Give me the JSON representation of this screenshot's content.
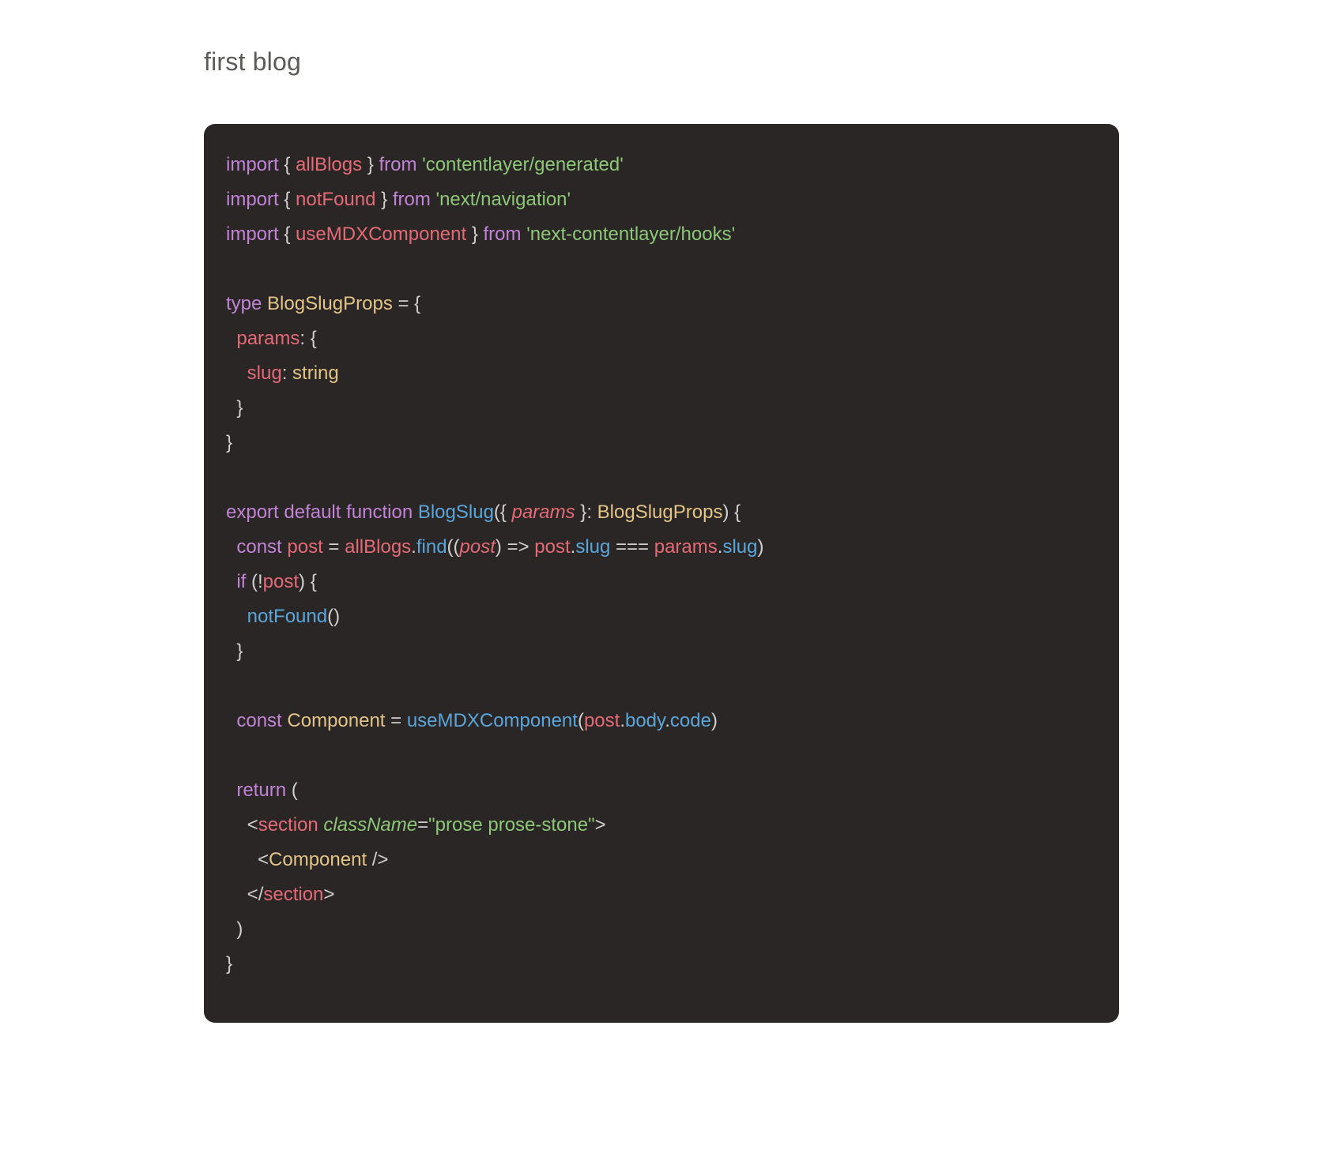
{
  "heading": "first blog",
  "code": {
    "lines": [
      [
        {
          "c": "kw",
          "t": "import"
        },
        {
          "c": "p",
          "t": " { "
        },
        {
          "c": "red",
          "t": "allBlogs"
        },
        {
          "c": "p",
          "t": " } "
        },
        {
          "c": "kw",
          "t": "from"
        },
        {
          "c": "p",
          "t": " "
        },
        {
          "c": "grn",
          "t": "'contentlayer/generated'"
        }
      ],
      [
        {
          "c": "kw",
          "t": "import"
        },
        {
          "c": "p",
          "t": " { "
        },
        {
          "c": "red",
          "t": "notFound"
        },
        {
          "c": "p",
          "t": " } "
        },
        {
          "c": "kw",
          "t": "from"
        },
        {
          "c": "p",
          "t": " "
        },
        {
          "c": "grn",
          "t": "'next/navigation'"
        }
      ],
      [
        {
          "c": "kw",
          "t": "import"
        },
        {
          "c": "p",
          "t": " { "
        },
        {
          "c": "red",
          "t": "useMDXComponent"
        },
        {
          "c": "p",
          "t": " } "
        },
        {
          "c": "kw",
          "t": "from"
        },
        {
          "c": "p",
          "t": " "
        },
        {
          "c": "grn",
          "t": "'next-contentlayer/hooks'"
        }
      ],
      [
        {
          "c": "p",
          "t": " "
        }
      ],
      [
        {
          "c": "kw",
          "t": "type"
        },
        {
          "c": "p",
          "t": " "
        },
        {
          "c": "yel",
          "t": "BlogSlugProps"
        },
        {
          "c": "p",
          "t": " = {"
        }
      ],
      [
        {
          "c": "p",
          "t": "  "
        },
        {
          "c": "red",
          "t": "params"
        },
        {
          "c": "p",
          "t": ": {"
        }
      ],
      [
        {
          "c": "p",
          "t": "    "
        },
        {
          "c": "red",
          "t": "slug"
        },
        {
          "c": "p",
          "t": ": "
        },
        {
          "c": "yel",
          "t": "string"
        }
      ],
      [
        {
          "c": "p",
          "t": "  }"
        }
      ],
      [
        {
          "c": "p",
          "t": "}"
        }
      ],
      [
        {
          "c": "p",
          "t": " "
        }
      ],
      [
        {
          "c": "kw",
          "t": "export"
        },
        {
          "c": "p",
          "t": " "
        },
        {
          "c": "kw",
          "t": "default"
        },
        {
          "c": "p",
          "t": " "
        },
        {
          "c": "kw",
          "t": "function"
        },
        {
          "c": "p",
          "t": " "
        },
        {
          "c": "blu",
          "t": "BlogSlug"
        },
        {
          "c": "p",
          "t": "({ "
        },
        {
          "c": "redit",
          "t": "params"
        },
        {
          "c": "p",
          "t": " }: "
        },
        {
          "c": "yel",
          "t": "BlogSlugProps"
        },
        {
          "c": "p",
          "t": ") {"
        }
      ],
      [
        {
          "c": "p",
          "t": "  "
        },
        {
          "c": "kw",
          "t": "const"
        },
        {
          "c": "p",
          "t": " "
        },
        {
          "c": "red",
          "t": "post"
        },
        {
          "c": "p",
          "t": " = "
        },
        {
          "c": "red",
          "t": "allBlogs"
        },
        {
          "c": "p",
          "t": "."
        },
        {
          "c": "blu",
          "t": "find"
        },
        {
          "c": "p",
          "t": "(("
        },
        {
          "c": "redit",
          "t": "post"
        },
        {
          "c": "p",
          "t": ") => "
        },
        {
          "c": "red",
          "t": "post"
        },
        {
          "c": "p",
          "t": "."
        },
        {
          "c": "blu",
          "t": "slug"
        },
        {
          "c": "p",
          "t": " === "
        },
        {
          "c": "red",
          "t": "params"
        },
        {
          "c": "p",
          "t": "."
        },
        {
          "c": "blu",
          "t": "slug"
        },
        {
          "c": "p",
          "t": ")"
        }
      ],
      [
        {
          "c": "p",
          "t": "  "
        },
        {
          "c": "kw",
          "t": "if"
        },
        {
          "c": "p",
          "t": " (!"
        },
        {
          "c": "red",
          "t": "post"
        },
        {
          "c": "p",
          "t": ") {"
        }
      ],
      [
        {
          "c": "p",
          "t": "    "
        },
        {
          "c": "blu",
          "t": "notFound"
        },
        {
          "c": "p",
          "t": "()"
        }
      ],
      [
        {
          "c": "p",
          "t": "  }"
        }
      ],
      [
        {
          "c": "p",
          "t": " "
        }
      ],
      [
        {
          "c": "p",
          "t": "  "
        },
        {
          "c": "kw",
          "t": "const"
        },
        {
          "c": "p",
          "t": " "
        },
        {
          "c": "yel",
          "t": "Component"
        },
        {
          "c": "p",
          "t": " = "
        },
        {
          "c": "blu",
          "t": "useMDXComponent"
        },
        {
          "c": "p",
          "t": "("
        },
        {
          "c": "red",
          "t": "post"
        },
        {
          "c": "p",
          "t": "."
        },
        {
          "c": "blu",
          "t": "body"
        },
        {
          "c": "p",
          "t": "."
        },
        {
          "c": "blu",
          "t": "code"
        },
        {
          "c": "p",
          "t": ")"
        }
      ],
      [
        {
          "c": "p",
          "t": " "
        }
      ],
      [
        {
          "c": "p",
          "t": "  "
        },
        {
          "c": "kw",
          "t": "return"
        },
        {
          "c": "p",
          "t": " ("
        }
      ],
      [
        {
          "c": "p",
          "t": "    <"
        },
        {
          "c": "red",
          "t": "section"
        },
        {
          "c": "p",
          "t": " "
        },
        {
          "c": "grnit",
          "t": "className"
        },
        {
          "c": "p",
          "t": "="
        },
        {
          "c": "grn",
          "t": "\"prose prose-stone\""
        },
        {
          "c": "p",
          "t": ">"
        }
      ],
      [
        {
          "c": "p",
          "t": "      <"
        },
        {
          "c": "yel",
          "t": "Component"
        },
        {
          "c": "p",
          "t": " />"
        }
      ],
      [
        {
          "c": "p",
          "t": "    </"
        },
        {
          "c": "red",
          "t": "section"
        },
        {
          "c": "p",
          "t": ">"
        }
      ],
      [
        {
          "c": "p",
          "t": "  )"
        }
      ],
      [
        {
          "c": "p",
          "t": "}"
        }
      ]
    ]
  }
}
